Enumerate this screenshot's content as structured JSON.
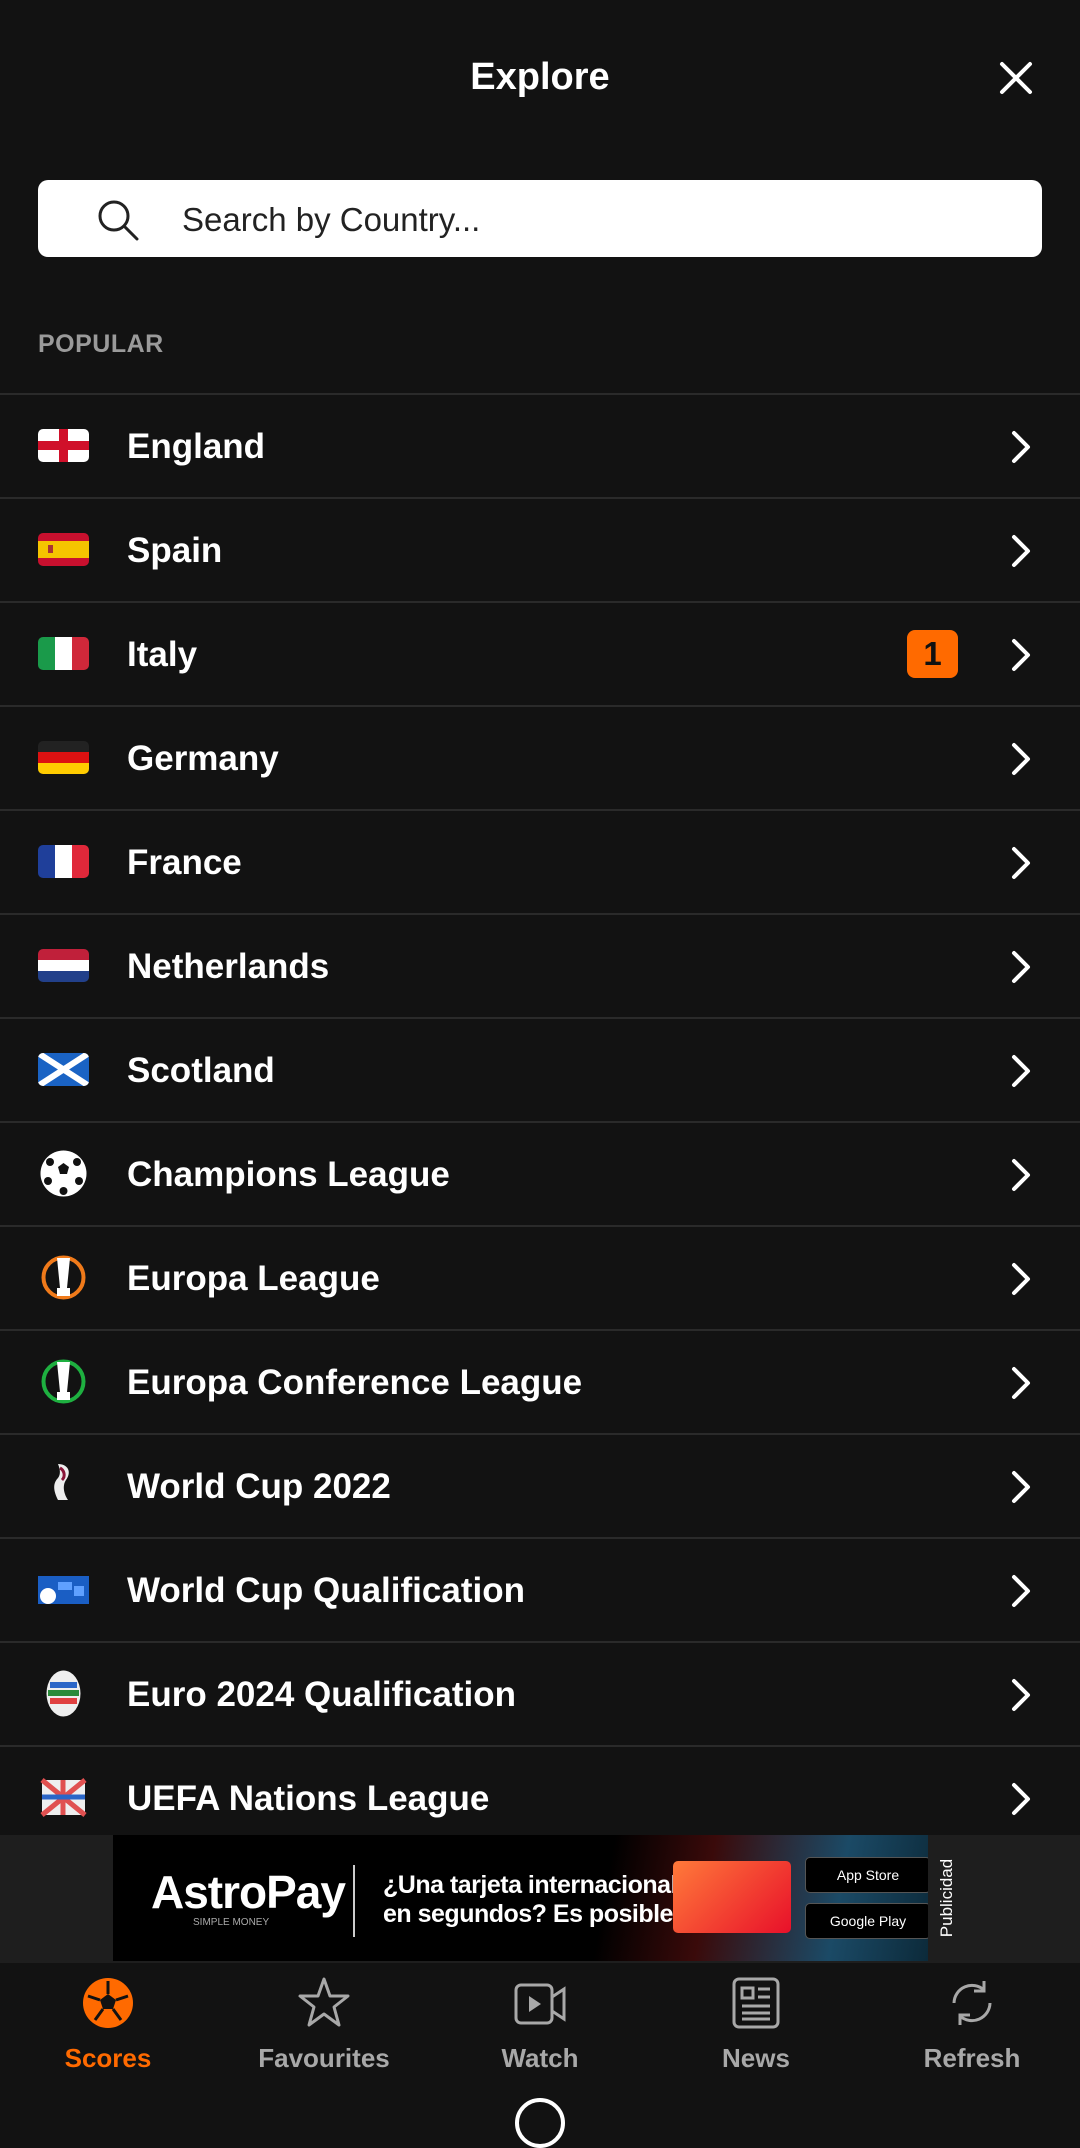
{
  "header": {
    "title": "Explore",
    "close_icon": "close-icon"
  },
  "search": {
    "placeholder": "Search by Country...",
    "value": ""
  },
  "section_label": "POPULAR",
  "accent_color": "#ff6a00",
  "items": [
    {
      "label": "England",
      "icon": "flag-england"
    },
    {
      "label": "Spain",
      "icon": "flag-spain"
    },
    {
      "label": "Italy",
      "icon": "flag-italy",
      "badge": "1"
    },
    {
      "label": "Germany",
      "icon": "flag-germany"
    },
    {
      "label": "France",
      "icon": "flag-france"
    },
    {
      "label": "Netherlands",
      "icon": "flag-netherlands"
    },
    {
      "label": "Scotland",
      "icon": "flag-scotland"
    },
    {
      "label": "Champions League",
      "icon": "champions-league-icon"
    },
    {
      "label": "Europa League",
      "icon": "europa-league-icon"
    },
    {
      "label": "Europa Conference League",
      "icon": "conference-league-icon"
    },
    {
      "label": "World Cup 2022",
      "icon": "world-cup-icon"
    },
    {
      "label": "World Cup Qualification",
      "icon": "world-cup-qualification-icon"
    },
    {
      "label": "Euro 2024 Qualification",
      "icon": "euro-2024-icon"
    },
    {
      "label": "UEFA Nations League",
      "icon": "nations-league-icon"
    }
  ],
  "ad": {
    "brand": "AstroPay",
    "tagline": "SIMPLE MONEY",
    "text_line1": "¿Una tarjeta internacional",
    "text_line2": "en segundos? Es posible.",
    "app_store": "App Store",
    "google_play": "Google Play",
    "label": "Publicidad"
  },
  "nav": [
    {
      "label": "Scores",
      "icon": "soccer-ball-icon",
      "active": true
    },
    {
      "label": "Favourites",
      "icon": "star-icon"
    },
    {
      "label": "Watch",
      "icon": "video-icon"
    },
    {
      "label": "News",
      "icon": "news-icon"
    },
    {
      "label": "Refresh",
      "icon": "refresh-icon"
    }
  ]
}
